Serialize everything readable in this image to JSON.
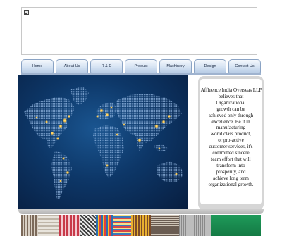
{
  "header": {
    "banner_image": "broken-image-icon"
  },
  "nav": {
    "items": [
      {
        "label": "Home"
      },
      {
        "label": "About Us"
      },
      {
        "label": "R & D"
      },
      {
        "label": "Product"
      },
      {
        "label": "Machinery"
      },
      {
        "label": "Design"
      },
      {
        "label": "Contact Us"
      }
    ]
  },
  "intro": {
    "heading": "Affluence India Overseas LLP",
    "lines": [
      "believes that",
      "Organizational",
      "growth can be",
      "achieved only through",
      "excellence. Be it in",
      "manufacturing",
      "world class product,",
      "or pro-active",
      "customer services, it's",
      "committed sincere",
      "team effort that will",
      "transform into",
      "prosperity, and",
      "achieve long term",
      "organizational growth."
    ]
  },
  "colors": {
    "nav_gradient_top": "#f4f8fd",
    "nav_gradient_bottom": "#b9cde6",
    "map_ocean": "#0d3768",
    "map_land": "#5a84b6",
    "city_lights": "#ffc440",
    "panel_gray": "#d6d6d6"
  },
  "images": {
    "world_map": "world-map-city-lights",
    "fabric_strip": "textile-swatches"
  }
}
